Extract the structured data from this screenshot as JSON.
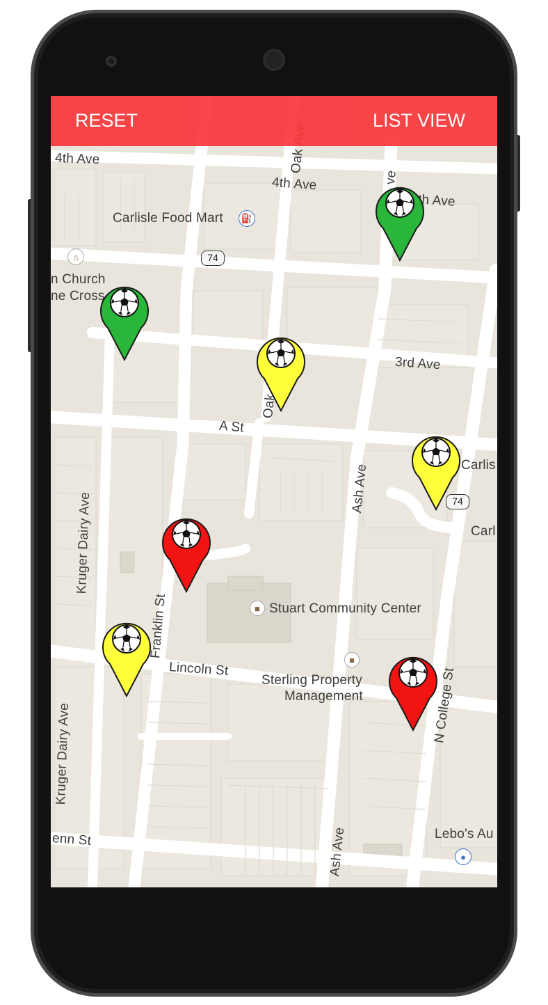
{
  "appbar": {
    "reset_label": "RESET",
    "list_view_label": "LIST VIEW",
    "color": "#f7383c"
  },
  "map": {
    "street_labels": {
      "fourth_ave_left": "4th Ave",
      "fourth_ave_mid": "4th Ave",
      "fourth_ave_right": "th Ave",
      "third_ave": "3rd Ave",
      "a_st": "A St",
      "lincoln_st": "Lincoln St",
      "glenn_st": "enn St",
      "oak_ave_top": "Oak Ave",
      "oak_ave_mid": "Oak",
      "ash_ave_top": "Ash Ave",
      "ash_ave_bottom": "Ash Ave",
      "kruger_dairy_top": "Kruger Dairy Ave",
      "kruger_dairy_bottom": "Kruger Dairy Ave",
      "franklin_st": "Franklin St",
      "n_college_st": "N College St",
      "top_right_ave": "ve"
    },
    "places": {
      "food_mart": "Carlisle Food Mart",
      "church_line1": "n Church",
      "church_line2": "ne Cross",
      "stuart_center": "Stuart Community Center",
      "sterling_line1": "Sterling Property",
      "sterling_line2": "Management",
      "carlisle_1": "Carlis",
      "carlisle_2": "Carl",
      "lebos": "Lebo's Au"
    },
    "route_badges": [
      "74",
      "74"
    ],
    "icons": {
      "food_mart_icon": "gas-station-icon",
      "church_icon": "church-icon",
      "stuart_icon": "place-icon",
      "sterling_icon": "place-icon",
      "lebos_icon": "shopping-icon"
    }
  },
  "markers": [
    {
      "status": "green",
      "color": "#2ab53b",
      "icon": "soccer-ball-icon"
    },
    {
      "status": "green",
      "color": "#2ab53b",
      "icon": "soccer-ball-icon"
    },
    {
      "status": "yellow",
      "color": "#ffff3c",
      "icon": "soccer-ball-icon"
    },
    {
      "status": "yellow",
      "color": "#ffff3c",
      "icon": "soccer-ball-icon"
    },
    {
      "status": "red",
      "color": "#f21313",
      "icon": "soccer-ball-icon"
    },
    {
      "status": "yellow",
      "color": "#ffff3c",
      "icon": "soccer-ball-icon"
    },
    {
      "status": "red",
      "color": "#f21313",
      "icon": "soccer-ball-icon"
    }
  ]
}
